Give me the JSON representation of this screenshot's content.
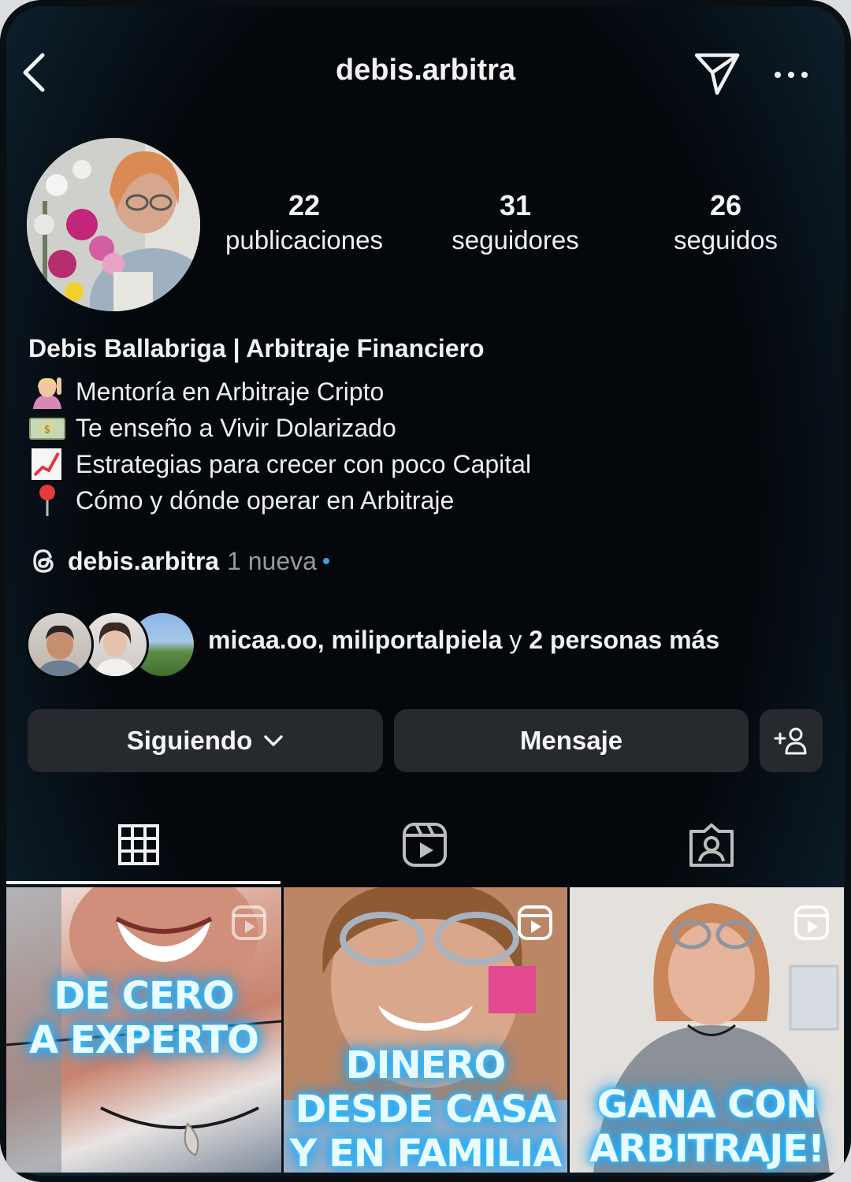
{
  "header": {
    "username": "debis.arbitra",
    "back_icon": "chevron-left-icon",
    "send_icon": "paper-plane-icon",
    "more_icon": "ellipsis-icon"
  },
  "stats": [
    {
      "value": "22",
      "label": "publicaciones"
    },
    {
      "value": "31",
      "label": "seguidores"
    },
    {
      "value": "26",
      "label": "seguidos"
    }
  ],
  "bio": {
    "full_name": "Debis Ballabriga | Arbitraje Financiero",
    "lines": [
      {
        "icon": "person-raising-hand-icon",
        "text": "Mentoría en Arbitraje Cripto"
      },
      {
        "icon": "dollar-banknote-icon",
        "text": "Te enseño a Vivir Dolarizado"
      },
      {
        "icon": "chart-increasing-icon",
        "text": "Estrategias para crecer con poco Capital"
      },
      {
        "icon": "round-pushpin-icon",
        "text": "Cómo y dónde operar en Arbitraje"
      }
    ]
  },
  "threads": {
    "handle": "debis.arbitra",
    "new_label": "1 nueva",
    "dot_color": "#3aa0e8"
  },
  "followed_by": {
    "names": "micaa.oo, miliportalpiela",
    "connector": "y",
    "more": "2 personas más"
  },
  "actions": {
    "following_label": "Siguiendo",
    "message_label": "Mensaje",
    "suggest_icon": "add-person-icon"
  },
  "tabs": [
    {
      "icon": "grid-icon",
      "active": true
    },
    {
      "icon": "reels-icon",
      "active": false
    },
    {
      "icon": "tagged-person-icon",
      "active": false
    }
  ],
  "posts": [
    {
      "caption_lines": [
        "DE CERO",
        "A EXPERTO"
      ],
      "type": "reel"
    },
    {
      "caption_lines": [
        "DINERO",
        "DESDE CASA",
        "Y EN FAMILIA"
      ],
      "type": "reel"
    },
    {
      "caption_lines": [
        "GANA CON",
        "ARBITRAJE!"
      ],
      "type": "reel"
    }
  ],
  "colors": {
    "background": "#04080d",
    "button": "#26292e",
    "caption_glow": "#1ea7ff"
  }
}
